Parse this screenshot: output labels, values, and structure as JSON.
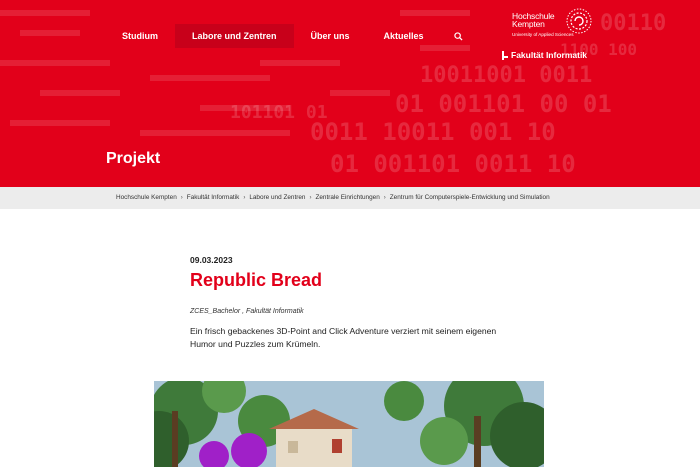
{
  "nav": {
    "items": [
      {
        "label": "Studium",
        "active": false
      },
      {
        "label": "Labore und Zentren",
        "active": true
      },
      {
        "label": "Über uns",
        "active": false
      },
      {
        "label": "Aktuelles",
        "active": false
      }
    ],
    "search_icon": "search-icon"
  },
  "logo": {
    "line1": "Hochschule",
    "line2": "Kempten",
    "subtitle": "University of Applied Sciences"
  },
  "faculty": {
    "label": "Fakultät Informatik",
    "icon": "faculty-marker-icon"
  },
  "page_title": "Projekt",
  "breadcrumb": [
    "Hochschule Kempten",
    "Fakultät Informatik",
    "Labore und Zentren",
    "Zentrale Einrichtungen",
    "Zentrum für Computerspiele-Entwicklung und Simulation"
  ],
  "article": {
    "date": "09.03.2023",
    "title": "Republic Bread",
    "tag1": "ZCES_Bachelor",
    "tag_sep": " , ",
    "tag2": "Fakultät Informatik",
    "description": "Ein frisch gebackenes 3D-Point and Click Adventure verziert mit seinem eigenen Humor und Puzzles zum Krümeln."
  },
  "colors": {
    "brand_red": "#e2001a",
    "breadcrumb_bg": "#ececec",
    "title_red": "#e2001a"
  }
}
